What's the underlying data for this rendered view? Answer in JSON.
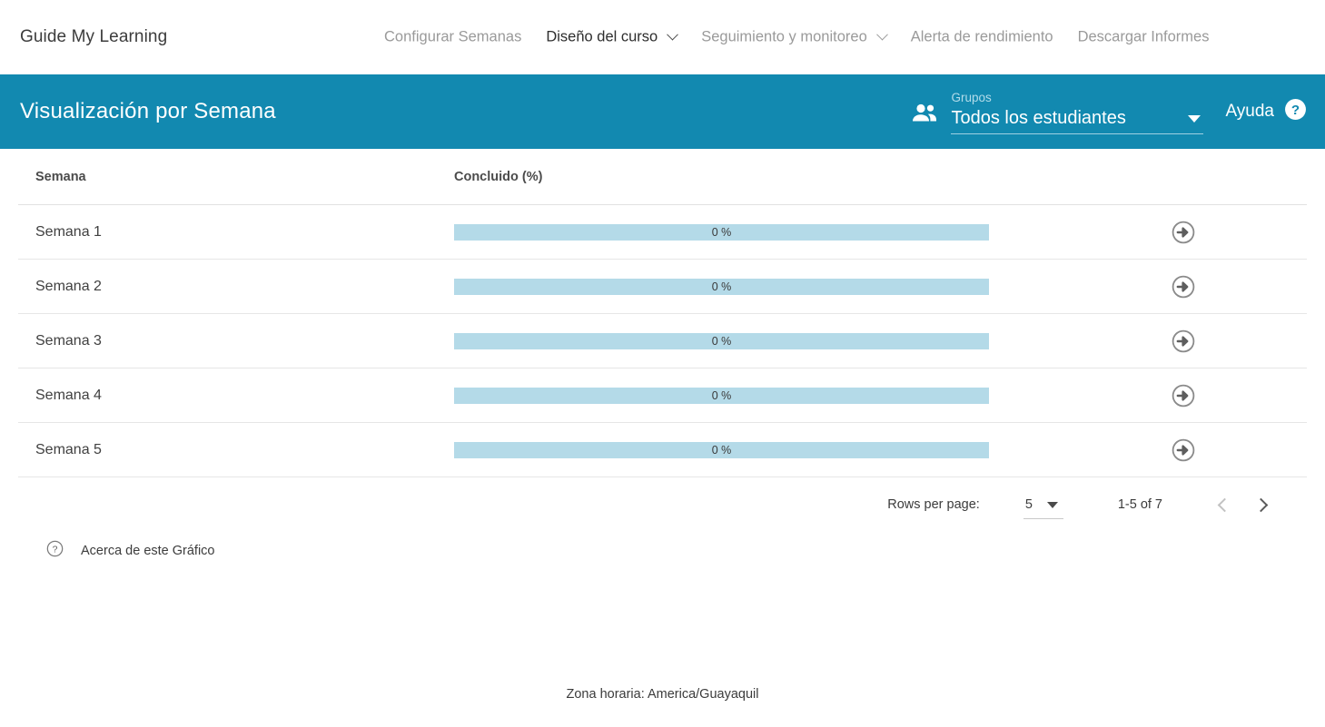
{
  "topnav": {
    "brand": "Guide My Learning",
    "items": [
      {
        "label": "Configurar Semanas",
        "has_caret": false,
        "active": false
      },
      {
        "label": "Diseño del curso",
        "has_caret": true,
        "active": true
      },
      {
        "label": "Seguimiento y monitoreo",
        "has_caret": true,
        "active": false
      },
      {
        "label": "Alerta de rendimiento",
        "has_caret": false,
        "active": false
      },
      {
        "label": "Descargar Informes",
        "has_caret": false,
        "active": false
      }
    ]
  },
  "subheader": {
    "title": "Visualización por Semana",
    "background_color": "#1289b0",
    "group_icon": "people-icon",
    "group_label": "Grupos",
    "group_value": "Todos los estudiantes",
    "help_label": "Ayuda",
    "help_icon": "help-circle-icon"
  },
  "table": {
    "headers": {
      "week": "Semana",
      "completed": "Concluido (%)",
      "action": ""
    },
    "bar_color": "#b4dae8",
    "rows": [
      {
        "week": "Semana 1",
        "percent_label": "0 %",
        "percent": 0,
        "action_icon": "arrow-right-circle-icon"
      },
      {
        "week": "Semana 2",
        "percent_label": "0 %",
        "percent": 0,
        "action_icon": "arrow-right-circle-icon"
      },
      {
        "week": "Semana 3",
        "percent_label": "0 %",
        "percent": 0,
        "action_icon": "arrow-right-circle-icon"
      },
      {
        "week": "Semana 4",
        "percent_label": "0 %",
        "percent": 0,
        "action_icon": "arrow-right-circle-icon"
      },
      {
        "week": "Semana 5",
        "percent_label": "0 %",
        "percent": 0,
        "action_icon": "arrow-right-circle-icon"
      }
    ]
  },
  "paginator": {
    "rows_per_page_label": "Rows per page:",
    "rows_per_page_value": "5",
    "range_label": "1-5 of 7",
    "prev_icon": "chevron-left-icon",
    "next_icon": "chevron-right-icon"
  },
  "about": {
    "icon": "help-circle-outline-icon",
    "label": "Acerca de este Gráfico"
  },
  "footer": {
    "timezone": "Zona horaria: America/Guayaquil"
  },
  "chart_data": {
    "type": "bar",
    "title": "Visualización por Semana",
    "xlabel": "Concluido (%)",
    "ylabel": "Semana",
    "categories": [
      "Semana 1",
      "Semana 2",
      "Semana 3",
      "Semana 4",
      "Semana 5"
    ],
    "values": [
      0,
      0,
      0,
      0,
      0
    ],
    "value_labels": [
      "0 %",
      "0 %",
      "0 %",
      "0 %",
      "0 %"
    ],
    "xlim": [
      0,
      100
    ],
    "grid": false,
    "legend": "none",
    "total_categories": 7,
    "shown_range": "1-5 of 7"
  }
}
